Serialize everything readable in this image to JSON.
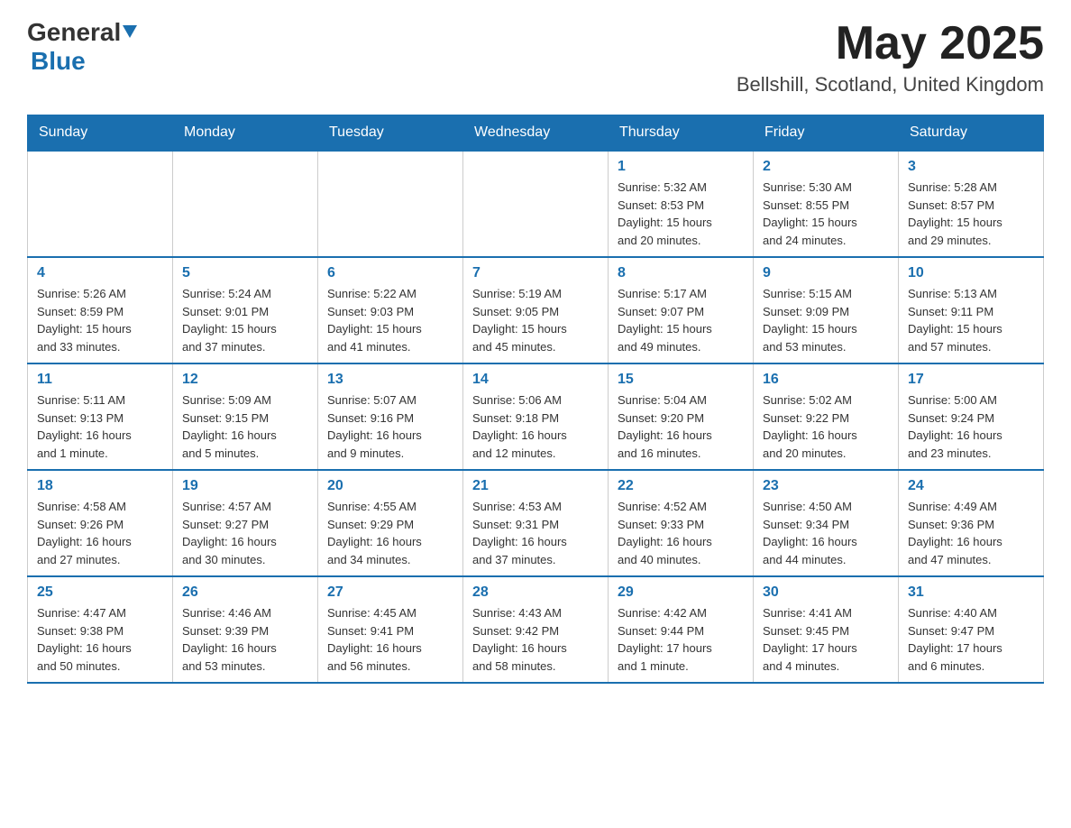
{
  "header": {
    "logo_general": "General",
    "logo_blue": "Blue",
    "month": "May 2025",
    "location": "Bellshill, Scotland, United Kingdom"
  },
  "weekdays": [
    "Sunday",
    "Monday",
    "Tuesday",
    "Wednesday",
    "Thursday",
    "Friday",
    "Saturday"
  ],
  "weeks": [
    [
      {
        "day": "",
        "info": ""
      },
      {
        "day": "",
        "info": ""
      },
      {
        "day": "",
        "info": ""
      },
      {
        "day": "",
        "info": ""
      },
      {
        "day": "1",
        "info": "Sunrise: 5:32 AM\nSunset: 8:53 PM\nDaylight: 15 hours\nand 20 minutes."
      },
      {
        "day": "2",
        "info": "Sunrise: 5:30 AM\nSunset: 8:55 PM\nDaylight: 15 hours\nand 24 minutes."
      },
      {
        "day": "3",
        "info": "Sunrise: 5:28 AM\nSunset: 8:57 PM\nDaylight: 15 hours\nand 29 minutes."
      }
    ],
    [
      {
        "day": "4",
        "info": "Sunrise: 5:26 AM\nSunset: 8:59 PM\nDaylight: 15 hours\nand 33 minutes."
      },
      {
        "day": "5",
        "info": "Sunrise: 5:24 AM\nSunset: 9:01 PM\nDaylight: 15 hours\nand 37 minutes."
      },
      {
        "day": "6",
        "info": "Sunrise: 5:22 AM\nSunset: 9:03 PM\nDaylight: 15 hours\nand 41 minutes."
      },
      {
        "day": "7",
        "info": "Sunrise: 5:19 AM\nSunset: 9:05 PM\nDaylight: 15 hours\nand 45 minutes."
      },
      {
        "day": "8",
        "info": "Sunrise: 5:17 AM\nSunset: 9:07 PM\nDaylight: 15 hours\nand 49 minutes."
      },
      {
        "day": "9",
        "info": "Sunrise: 5:15 AM\nSunset: 9:09 PM\nDaylight: 15 hours\nand 53 minutes."
      },
      {
        "day": "10",
        "info": "Sunrise: 5:13 AM\nSunset: 9:11 PM\nDaylight: 15 hours\nand 57 minutes."
      }
    ],
    [
      {
        "day": "11",
        "info": "Sunrise: 5:11 AM\nSunset: 9:13 PM\nDaylight: 16 hours\nand 1 minute."
      },
      {
        "day": "12",
        "info": "Sunrise: 5:09 AM\nSunset: 9:15 PM\nDaylight: 16 hours\nand 5 minutes."
      },
      {
        "day": "13",
        "info": "Sunrise: 5:07 AM\nSunset: 9:16 PM\nDaylight: 16 hours\nand 9 minutes."
      },
      {
        "day": "14",
        "info": "Sunrise: 5:06 AM\nSunset: 9:18 PM\nDaylight: 16 hours\nand 12 minutes."
      },
      {
        "day": "15",
        "info": "Sunrise: 5:04 AM\nSunset: 9:20 PM\nDaylight: 16 hours\nand 16 minutes."
      },
      {
        "day": "16",
        "info": "Sunrise: 5:02 AM\nSunset: 9:22 PM\nDaylight: 16 hours\nand 20 minutes."
      },
      {
        "day": "17",
        "info": "Sunrise: 5:00 AM\nSunset: 9:24 PM\nDaylight: 16 hours\nand 23 minutes."
      }
    ],
    [
      {
        "day": "18",
        "info": "Sunrise: 4:58 AM\nSunset: 9:26 PM\nDaylight: 16 hours\nand 27 minutes."
      },
      {
        "day": "19",
        "info": "Sunrise: 4:57 AM\nSunset: 9:27 PM\nDaylight: 16 hours\nand 30 minutes."
      },
      {
        "day": "20",
        "info": "Sunrise: 4:55 AM\nSunset: 9:29 PM\nDaylight: 16 hours\nand 34 minutes."
      },
      {
        "day": "21",
        "info": "Sunrise: 4:53 AM\nSunset: 9:31 PM\nDaylight: 16 hours\nand 37 minutes."
      },
      {
        "day": "22",
        "info": "Sunrise: 4:52 AM\nSunset: 9:33 PM\nDaylight: 16 hours\nand 40 minutes."
      },
      {
        "day": "23",
        "info": "Sunrise: 4:50 AM\nSunset: 9:34 PM\nDaylight: 16 hours\nand 44 minutes."
      },
      {
        "day": "24",
        "info": "Sunrise: 4:49 AM\nSunset: 9:36 PM\nDaylight: 16 hours\nand 47 minutes."
      }
    ],
    [
      {
        "day": "25",
        "info": "Sunrise: 4:47 AM\nSunset: 9:38 PM\nDaylight: 16 hours\nand 50 minutes."
      },
      {
        "day": "26",
        "info": "Sunrise: 4:46 AM\nSunset: 9:39 PM\nDaylight: 16 hours\nand 53 minutes."
      },
      {
        "day": "27",
        "info": "Sunrise: 4:45 AM\nSunset: 9:41 PM\nDaylight: 16 hours\nand 56 minutes."
      },
      {
        "day": "28",
        "info": "Sunrise: 4:43 AM\nSunset: 9:42 PM\nDaylight: 16 hours\nand 58 minutes."
      },
      {
        "day": "29",
        "info": "Sunrise: 4:42 AM\nSunset: 9:44 PM\nDaylight: 17 hours\nand 1 minute."
      },
      {
        "day": "30",
        "info": "Sunrise: 4:41 AM\nSunset: 9:45 PM\nDaylight: 17 hours\nand 4 minutes."
      },
      {
        "day": "31",
        "info": "Sunrise: 4:40 AM\nSunset: 9:47 PM\nDaylight: 17 hours\nand 6 minutes."
      }
    ]
  ]
}
